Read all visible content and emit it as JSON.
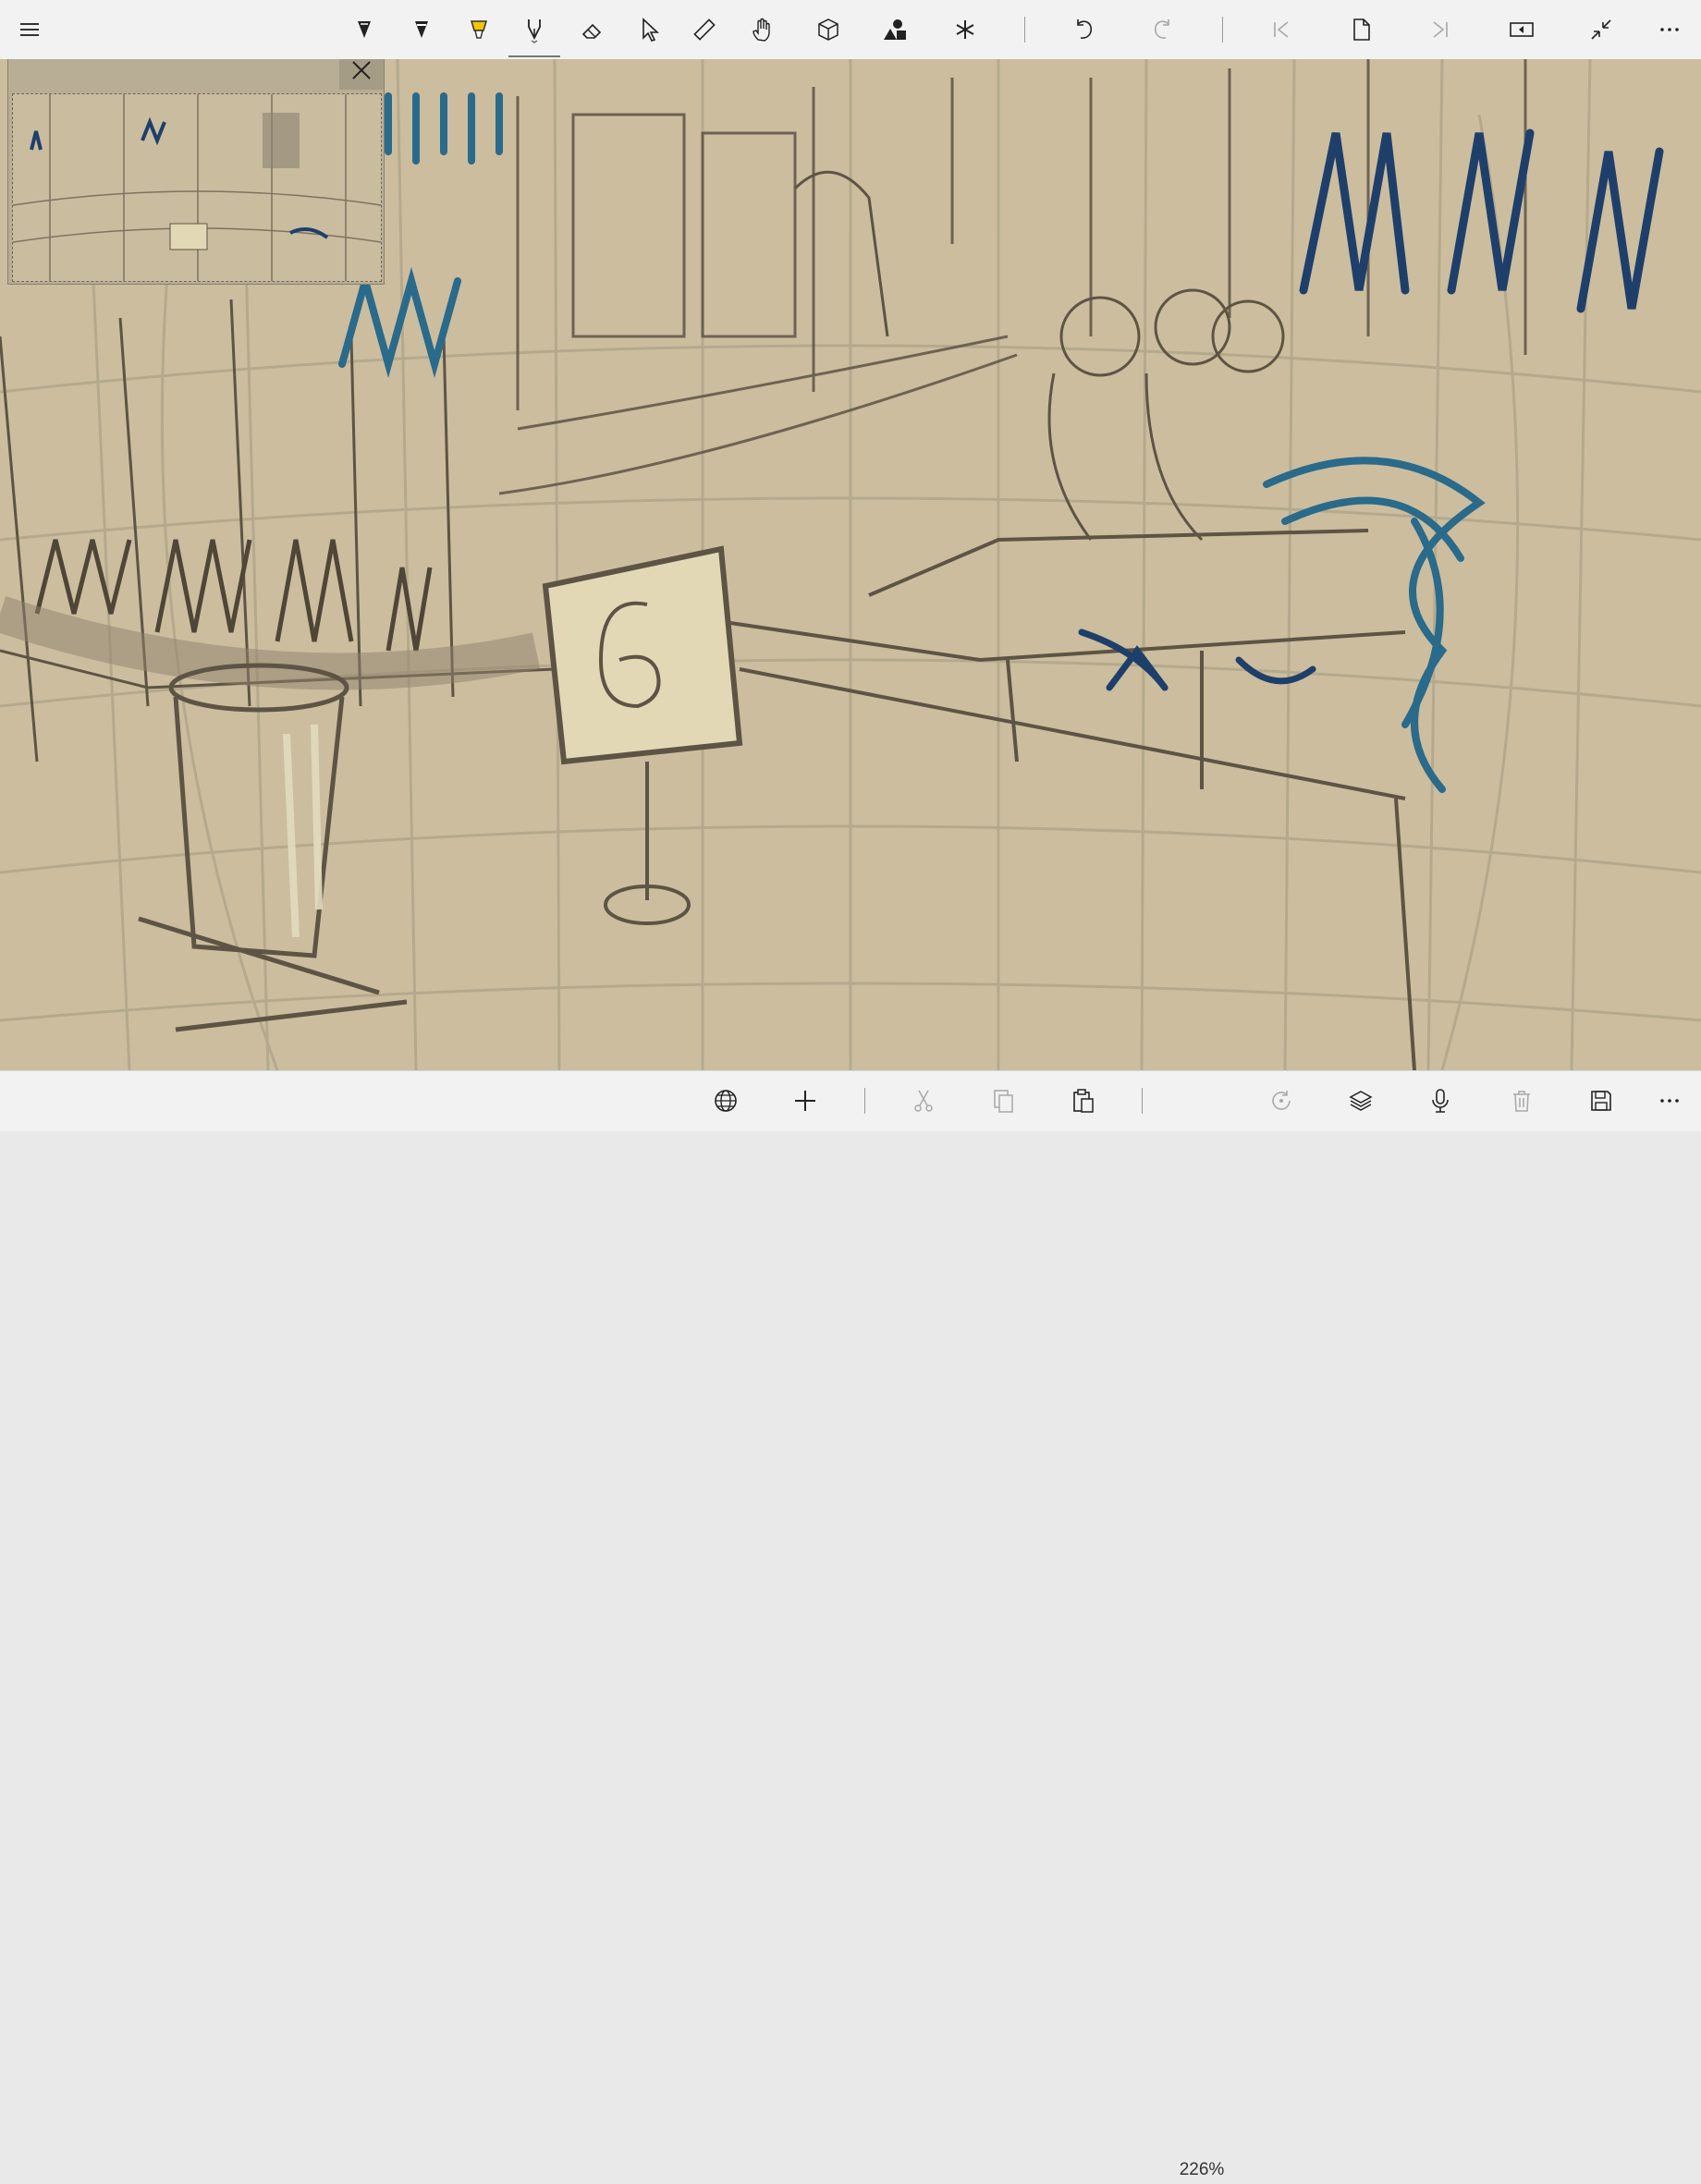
{
  "toolbar": {
    "tools": [
      {
        "name": "pen-tool",
        "icon": "pen-nib-icon"
      },
      {
        "name": "marker-tool",
        "icon": "marker-nib-icon"
      },
      {
        "name": "highlighter-tool",
        "icon": "highlighter-icon",
        "color": "#f2c500"
      },
      {
        "name": "ink-tool",
        "icon": "fountain-pen-icon",
        "selected": true
      },
      {
        "name": "eraser-tool",
        "icon": "eraser-icon"
      },
      {
        "name": "select-tool",
        "icon": "pointer-icon"
      },
      {
        "name": "ruler-tool",
        "icon": "ruler-icon"
      },
      {
        "name": "touch-draw-tool",
        "icon": "hand-icon"
      },
      {
        "name": "3d-tool",
        "icon": "cube-icon"
      },
      {
        "name": "shapes-tool",
        "icon": "shapes-icon"
      },
      {
        "name": "symmetry-tool",
        "icon": "asterisk-icon"
      }
    ],
    "actions": [
      "undo-icon",
      "redo-icon",
      "first-page-icon",
      "page-icon",
      "last-page-icon",
      "present-icon",
      "collapse-icon",
      "more-icon"
    ]
  },
  "bottombar": {
    "zoom_label": "226%",
    "actions": [
      "globe-icon",
      "plus-icon",
      "cut-icon",
      "copy-icon",
      "paste-icon",
      "rotate-icon",
      "layers-icon",
      "microphone-icon",
      "delete-icon",
      "save-icon",
      "more-icon"
    ]
  },
  "colors": {
    "paper": "#cbbd9e",
    "ink": "#5e5445",
    "blue_ink": "#1f3f6b",
    "teal_ink": "#2a6a8a",
    "highlight": "#f2c500"
  }
}
